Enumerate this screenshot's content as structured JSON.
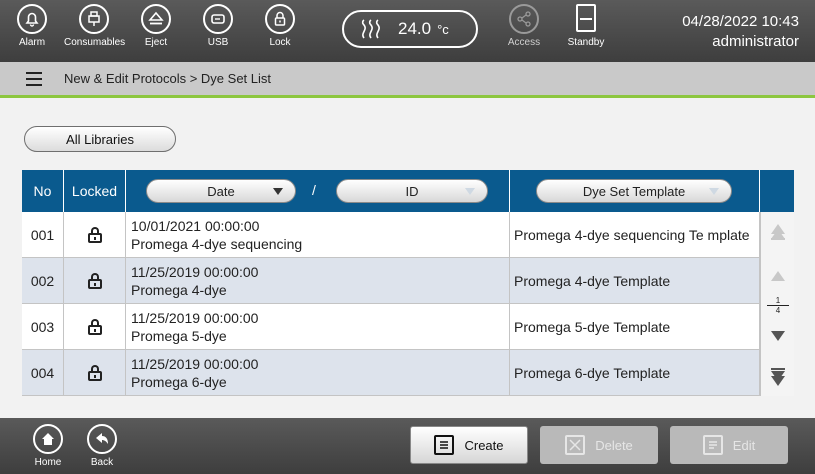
{
  "topbar": {
    "buttons": [
      {
        "label": "Alarm",
        "icon": "bell-icon"
      },
      {
        "label": "Consumables",
        "icon": "consumables-icon"
      },
      {
        "label": "Eject",
        "icon": "eject-icon"
      },
      {
        "label": "USB",
        "icon": "usb-icon"
      },
      {
        "label": "Lock",
        "icon": "lock-icon"
      }
    ],
    "temperature": {
      "value": "24.0",
      "unit": "°c",
      "icon": "heater-icon"
    },
    "access": {
      "label": "Access",
      "icon": "share-icon",
      "disabled": true
    },
    "standby": {
      "label": "Standby",
      "icon": "standby-icon"
    },
    "date": "04/28/2022 10:43",
    "user": "administrator"
  },
  "breadcrumb": {
    "icon": "menu-list-icon",
    "text": "New & Edit Protocols > Dye Set List"
  },
  "library_button": "All Libraries",
  "table": {
    "headers": {
      "no": "No",
      "locked": "Locked",
      "date": "Date",
      "separator": "/",
      "id": "ID",
      "template": "Dye Set Template"
    },
    "rows": [
      {
        "no": "001",
        "date": "10/01/2021 00:00:00",
        "id": "Promega 4-dye sequencing",
        "template": "Promega 4-dye sequencing Te mplate",
        "locked": true
      },
      {
        "no": "002",
        "date": "11/25/2019 00:00:00",
        "id": "Promega 4-dye",
        "template": "Promega 4-dye Template",
        "locked": true
      },
      {
        "no": "003",
        "date": "11/25/2019 00:00:00",
        "id": "Promega 5-dye",
        "template": "Promega 5-dye Template",
        "locked": true
      },
      {
        "no": "004",
        "date": "11/25/2019 00:00:00",
        "id": "Promega 6-dye",
        "template": "Promega 6-dye Template",
        "locked": true
      }
    ],
    "pager": {
      "current": "1",
      "total": "4"
    }
  },
  "bottombar": {
    "home": "Home",
    "back": "Back",
    "create": "Create",
    "delete": "Delete",
    "edit": "Edit"
  },
  "colors": {
    "header": "#0a5a8e",
    "accent_line": "#8cc63f",
    "row_alt": "#dde3ec"
  }
}
